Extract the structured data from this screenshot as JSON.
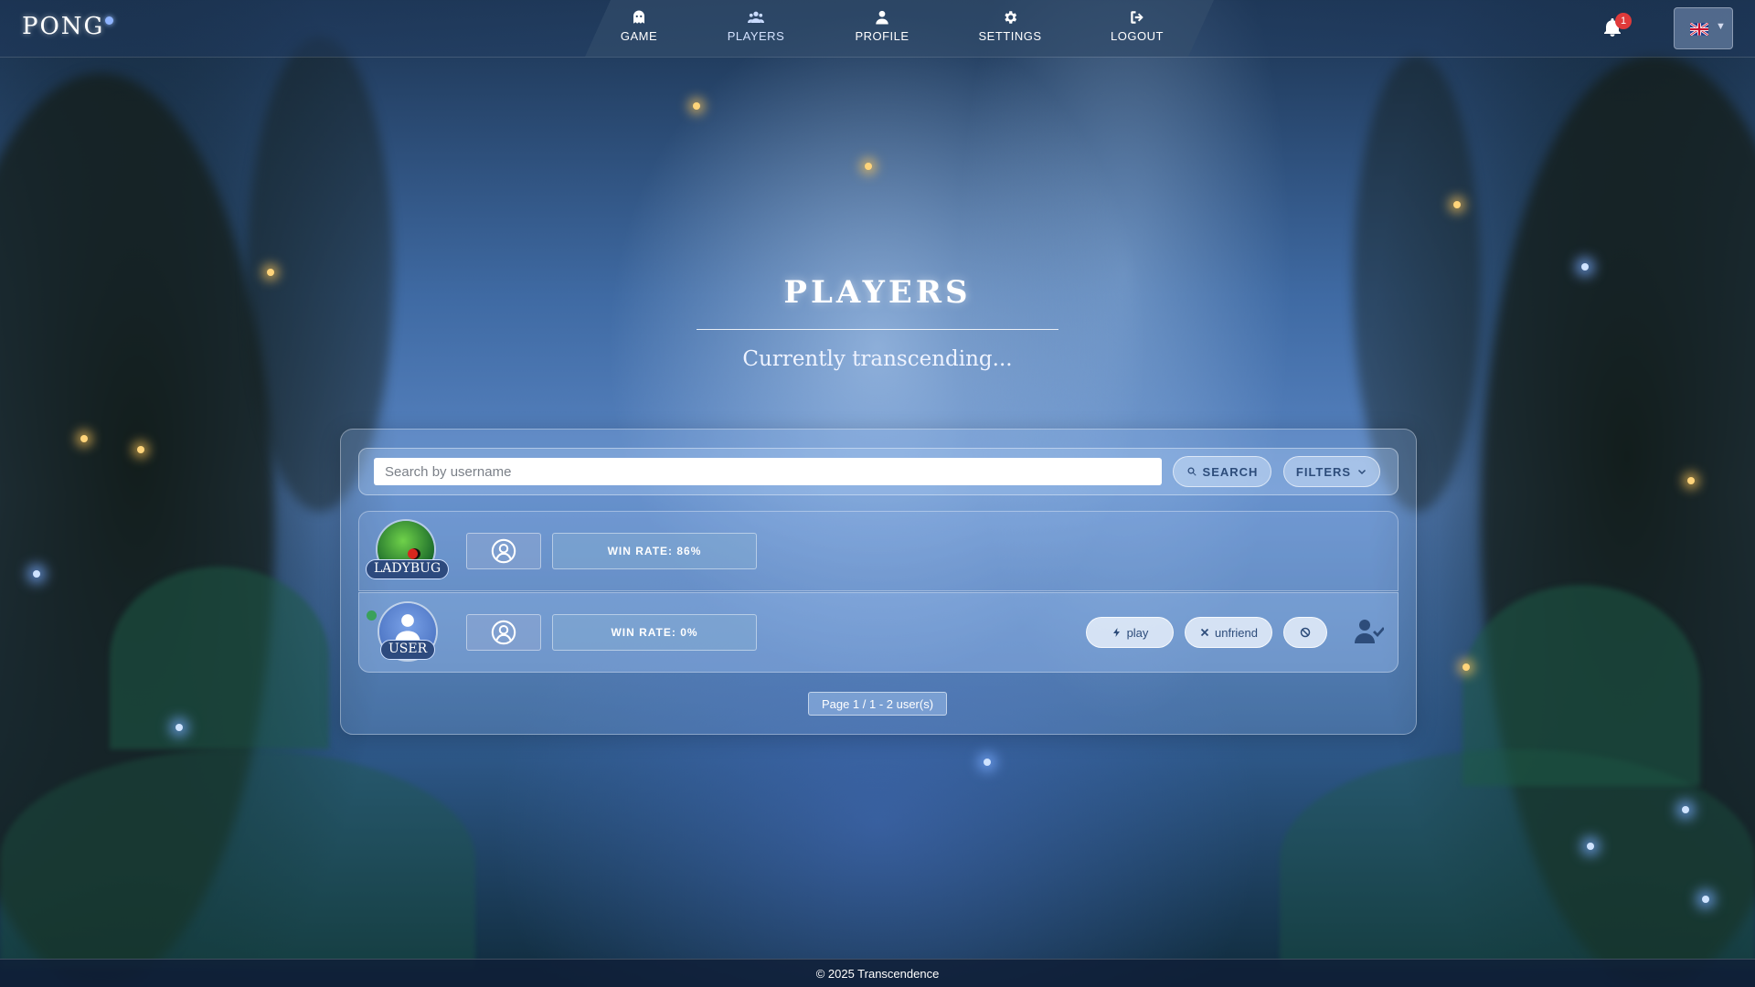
{
  "app": {
    "logo": "PONG"
  },
  "nav": {
    "items": [
      {
        "label": "GAME",
        "icon": "ghost-icon"
      },
      {
        "label": "PLAYERS",
        "icon": "users-icon"
      },
      {
        "label": "PROFILE",
        "icon": "user-icon"
      },
      {
        "label": "SETTINGS",
        "icon": "gear-icon"
      },
      {
        "label": "LOGOUT",
        "icon": "logout-icon"
      }
    ],
    "active": "PLAYERS",
    "notifications_count": "1",
    "language_icon": "uk-flag-icon"
  },
  "hero": {
    "title": "PLAYERS",
    "subtitle": "Currently transcending..."
  },
  "search": {
    "placeholder": "Search by username",
    "search_label": "SEARCH",
    "filters_label": "FILTERS"
  },
  "players": [
    {
      "username": "LADYBUG",
      "win_rate": "WIN RATE: 86%",
      "online": false
    },
    {
      "username": "USER",
      "win_rate": "WIN RATE: 0%",
      "online": true,
      "actions": {
        "play": "play",
        "unfriend": "unfriend",
        "block_icon": "ban-icon",
        "status_icon": "user-check-icon"
      }
    }
  ],
  "pagination": {
    "text": "Page 1 / 1 - 2 user(s)"
  },
  "footer": {
    "text": "© 2025 Transcendence"
  },
  "colors": {
    "accent": "#2d4c7a",
    "badge": "#e03a3a",
    "online": "#3aa15b",
    "tag": "#2d4a7e"
  }
}
